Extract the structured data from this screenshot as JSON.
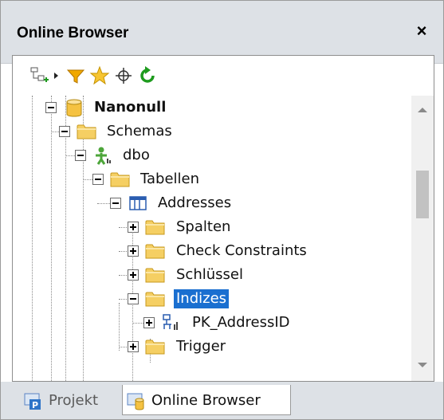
{
  "panel": {
    "title": "Online Browser",
    "close_glyph": "×"
  },
  "toolbar": {
    "buttons": [
      "add-datasource-icon",
      "dropdown-arrow-icon",
      "filter-icon",
      "favorite-star-icon",
      "locate-crosshair-icon",
      "refresh-icon"
    ]
  },
  "tree": {
    "nodes": [
      {
        "label": "Nanonull",
        "icon": "database-icon",
        "state": "expanded",
        "level": 0,
        "bold": true
      },
      {
        "label": "Schemas",
        "icon": "folder-icon",
        "state": "expanded",
        "level": 1
      },
      {
        "label": "dbo",
        "icon": "schema-user-icon",
        "state": "expanded",
        "level": 2
      },
      {
        "label": "Tabellen",
        "icon": "folder-icon",
        "state": "expanded",
        "level": 3
      },
      {
        "label": "Addresses",
        "icon": "table-icon",
        "state": "expanded",
        "level": 4
      },
      {
        "label": "Spalten",
        "icon": "folder-icon",
        "state": "collapsed",
        "level": 5
      },
      {
        "label": "Check Constraints",
        "icon": "folder-icon",
        "state": "collapsed",
        "level": 5
      },
      {
        "label": "Schlüssel",
        "icon": "folder-icon",
        "state": "collapsed",
        "level": 5
      },
      {
        "label": "Indizes",
        "icon": "folder-icon",
        "state": "expanded",
        "level": 5,
        "selected": true
      },
      {
        "label": "PK_AddressID",
        "icon": "index-icon",
        "state": "collapsed",
        "level": 6
      },
      {
        "label": "Trigger",
        "icon": "folder-icon",
        "state": "collapsed",
        "level": 5
      }
    ]
  },
  "tabs": [
    {
      "label": "Projekt",
      "active": false,
      "icon": "project-icon"
    },
    {
      "label": "Online Browser",
      "active": true,
      "icon": "online-browser-icon"
    }
  ],
  "colors": {
    "selection": "#1a6fd0",
    "folder": "#f5cf63",
    "titlebar": "#dde1e6",
    "refresh": "#1e9b1e"
  }
}
